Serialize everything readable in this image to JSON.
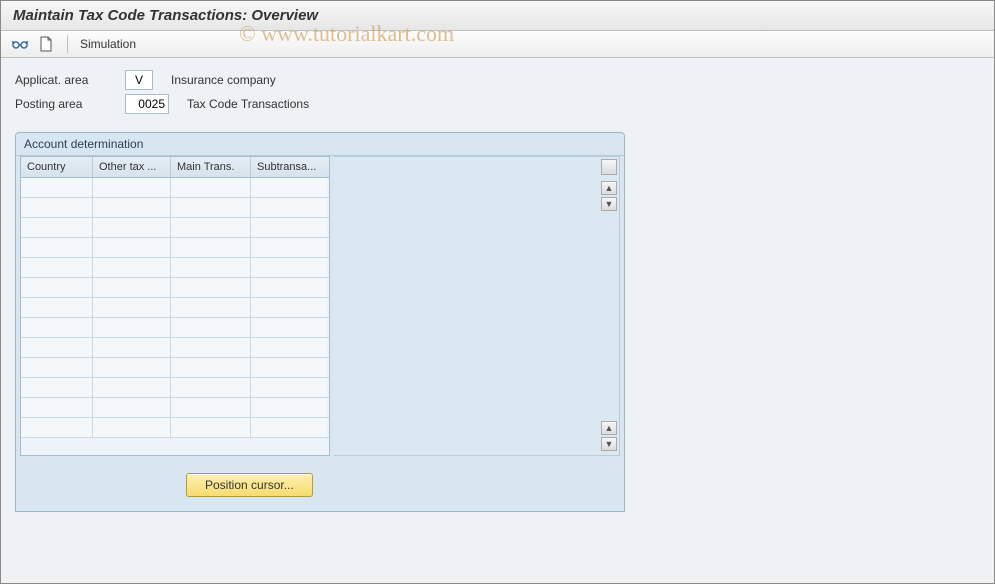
{
  "title": "Maintain Tax Code Transactions: Overview",
  "watermark": "© www.tutorialkart.com",
  "toolbar": {
    "simulation_label": "Simulation"
  },
  "fields": {
    "applicat_area": {
      "label": "Applicat. area",
      "value": "V",
      "desc": "Insurance company"
    },
    "posting_area": {
      "label": "Posting area",
      "value": "0025",
      "desc": "Tax Code Transactions"
    }
  },
  "panel": {
    "title": "Account determination",
    "columns": [
      "Country",
      "Other tax ...",
      "Main Trans.",
      "Subtransa..."
    ],
    "row_count": 13
  },
  "buttons": {
    "position_cursor": "Position cursor..."
  }
}
